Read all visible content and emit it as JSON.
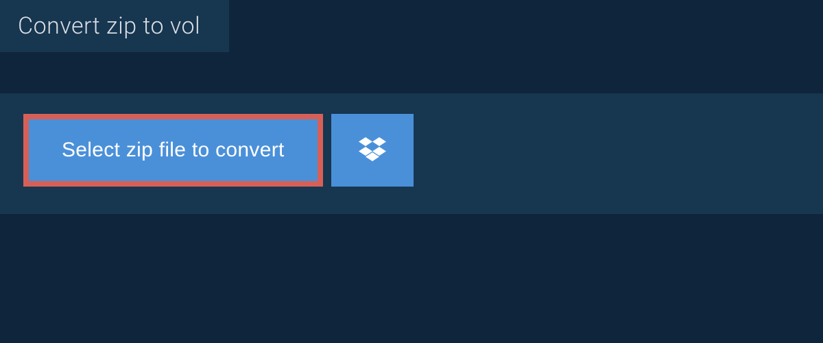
{
  "tab": {
    "title": "Convert zip to vol"
  },
  "actions": {
    "select_label": "Select zip file to convert"
  },
  "icons": {
    "dropbox": "dropbox"
  },
  "colors": {
    "bg": "#0f253c",
    "panel": "#173650",
    "accent": "#4a90d9",
    "highlight_border": "#d66057"
  }
}
